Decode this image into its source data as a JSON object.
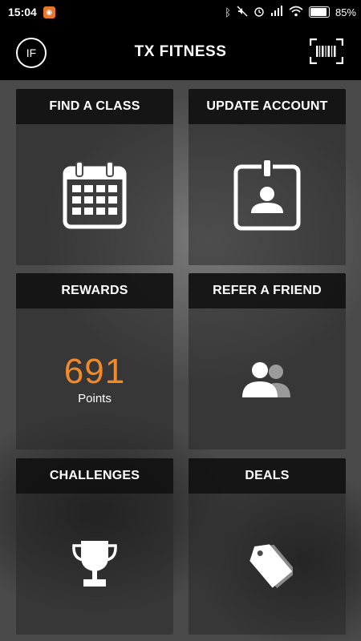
{
  "status_bar": {
    "time": "15:04",
    "battery": "85%",
    "battery_level": 0.85,
    "icons": [
      "bluetooth-icon",
      "mute-icon",
      "alarm-icon",
      "signal-icon",
      "wifi-icon",
      "battery-icon"
    ]
  },
  "header": {
    "profile_initials": "IF",
    "title": "TX FITNESS",
    "barcode_icon": "barcode-scan-icon"
  },
  "tiles": [
    {
      "label": "FIND A CLASS",
      "icon": "calendar-icon"
    },
    {
      "label": "UPDATE ACCOUNT",
      "icon": "id-badge-icon"
    },
    {
      "label": "REWARDS",
      "points": "691",
      "points_label": "Points"
    },
    {
      "label": "REFER A FRIEND",
      "icon": "users-icon"
    },
    {
      "label": "CHALLENGES",
      "icon": "trophy-icon"
    },
    {
      "label": "DEALS",
      "icon": "tag-icon"
    }
  ],
  "colors": {
    "accent": "#f08a2a",
    "header_bg": "#000000"
  }
}
